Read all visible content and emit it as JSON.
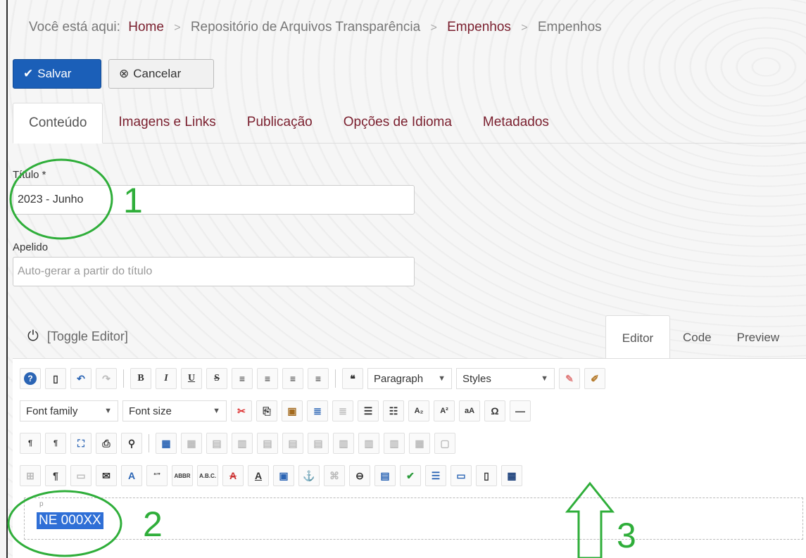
{
  "breadcrumb": {
    "prefix": "Você está aqui:",
    "items": [
      "Home",
      "Repositório de Arquivos Transparência",
      "Empenhos",
      "Empenhos"
    ]
  },
  "toolbar": {
    "save_label": "Salvar",
    "cancel_label": "Cancelar"
  },
  "tabs": [
    "Conteúdo",
    "Imagens e Links",
    "Publicação",
    "Opções de Idioma",
    "Metadados"
  ],
  "form": {
    "title_label": "Título *",
    "title_value": "2023 - Junho",
    "alias_label": "Apelido",
    "alias_placeholder": "Auto-gerar a partir do título"
  },
  "editor": {
    "toggle_label": "[Toggle Editor]",
    "tabs": [
      "Editor",
      "Code",
      "Preview"
    ],
    "format_select": "Paragraph",
    "styles_select": "Styles",
    "font_family_select": "Font family",
    "font_size_select": "Font size",
    "path_label": "p",
    "selected_text": "NE 000XX"
  },
  "annotations": [
    "1",
    "2",
    "3"
  ],
  "colors": {
    "accent_link": "#7a1f2e",
    "save_button": "#1b5fb8",
    "annotation_green": "#2fae3a",
    "selection_blue": "#2f6fd6"
  }
}
